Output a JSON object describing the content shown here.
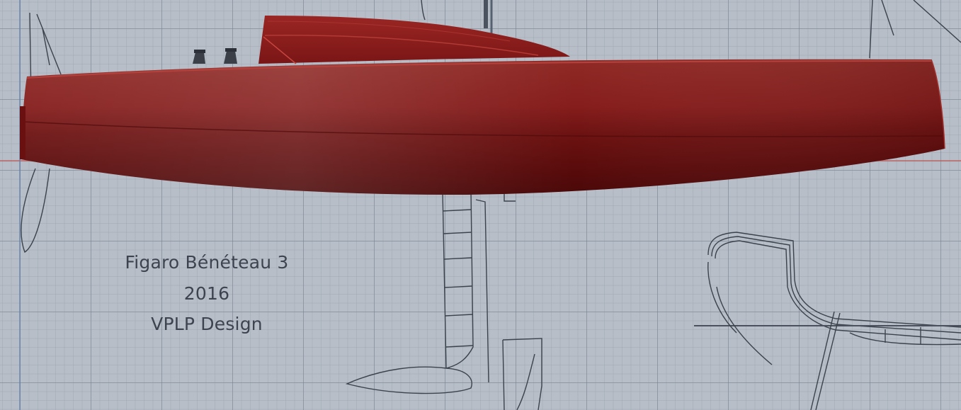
{
  "scene": {
    "boat_model": "Figaro Bénéteau 3",
    "year": "2016",
    "designer": "VPLP Design",
    "hull_color": "#8a1c1c",
    "background_color": "#b7bec8",
    "grid_color": "#7a8291",
    "axis_red_color": "#c0504d",
    "axis_blue_color": "#5f7fb0"
  }
}
